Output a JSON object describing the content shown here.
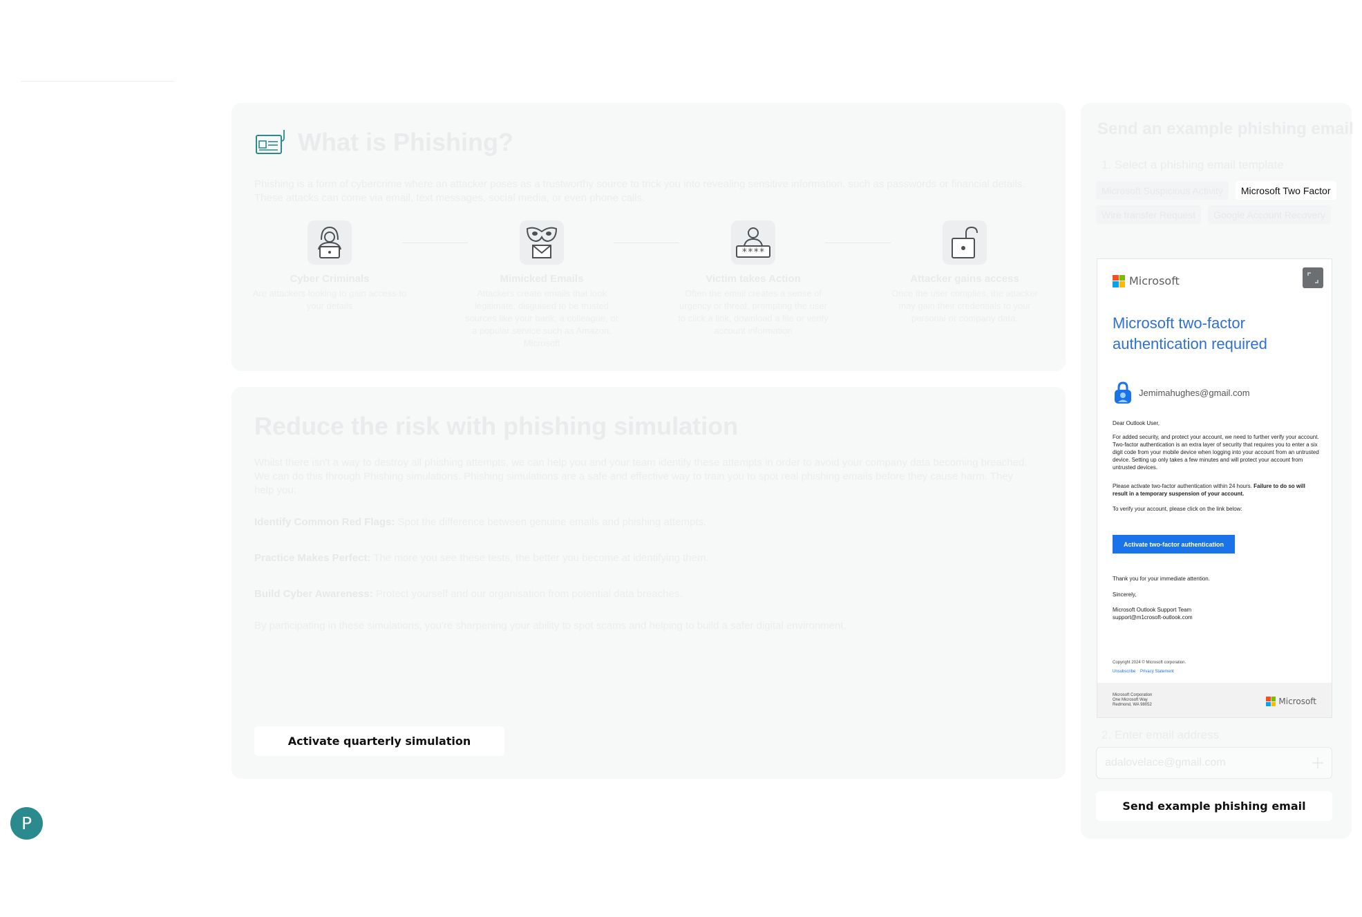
{
  "sidebar": {
    "avatar_initial": "P"
  },
  "what_is": {
    "title": "What is Phishing?",
    "intro": "Phishing is a form of cybercrime where an attacker poses as a trustworthy source to trick you into revealing sensitive information, such as passwords or financial details. These attacks can come via email, text messages, social media, or even phone calls.",
    "steps": [
      {
        "title": "Cyber Criminals",
        "desc": "Are attackers looking to gain access to your details",
        "icon": "hacker-icon"
      },
      {
        "title": "Mimicked Emails",
        "desc": "Attackers create emails that look legitimate, disguised to be trusted sources like your bank, a colleague, or a popular service such as Amazon, Microsoft",
        "icon": "mask-email-icon"
      },
      {
        "title": "Victim takes Action",
        "desc": "Often the email creates a sense of urgency or threat, prompting the user to click a link, download a file or verify account information",
        "icon": "password-user-icon"
      },
      {
        "title": "Attacker gains access",
        "desc": "Once the user complies, the attacker may gain their credentials to your personal or company data.",
        "icon": "unlock-icon"
      }
    ]
  },
  "reduce": {
    "title": "Reduce the risk with phishing simulation",
    "intro": "Whilst there isn't a way to destroy all phishing attempts, we can help you and your team identify these attempts in order to avoid your company data becoming breached. We can do this through Phishing simulations. Phishing simulations are a safe and effective way to train you to spot real phishing emails before they cause harm. They help you:",
    "points": [
      {
        "label": "Identify Common Red Flags:",
        "text": "Spot the difference between genuine emails and phishing attempts."
      },
      {
        "label": "Practice Makes Perfect:",
        "text": "The more you see these tests, the better you become at identifying them."
      },
      {
        "label": "Build Cyber Awareness:",
        "text": "Protect yourself and our organisation from potential data breaches."
      }
    ],
    "outro": "By participating in these simulations, you're sharpening your ability to spot scams and helping to build a safer digital environment.",
    "button": "Activate quarterly simulation"
  },
  "send_panel": {
    "title": "Send an example phishing email",
    "step1": "1.  Select a phishing email template",
    "templates": [
      {
        "label": "Microsoft Suspicious Activity",
        "selected": false
      },
      {
        "label": "Microsoft Two Factor",
        "selected": true
      },
      {
        "label": "Wire transfer Request",
        "selected": false
      },
      {
        "label": "Google Account Recovery",
        "selected": false
      }
    ],
    "step2": "2.  Enter email address",
    "email_placeholder": "adalovelace@gmail.com",
    "send_button": "Send example phishing email"
  },
  "email_preview": {
    "brand": "Microsoft",
    "title": "Microsoft two-factor authentication required",
    "recipient": "Jemimahughes@gmail.com",
    "greeting": "Dear Outlook User,",
    "para1": "For added security, and protect your account, we need to further verify your account. Two-factor authentication is an extra layer of security that requires you to enter a six digit code from your mobile device when logging into your account from an untrusted device. Setting up only takes a few minutes and will protect your account from untrusted devices.",
    "para2_plain": "Please activate two-factor authentication within 24 hours.",
    "para2_bold": "Failure to do so will result in a temporary suspension of your account.",
    "para3": "To verify your account, please click on the link below:",
    "cta": "Activate two-factor authentication",
    "thanks": "Thank you for your immediate attention.",
    "sincerely": "Sincerely,",
    "team": "Microsoft Outlook Support Team",
    "support_email": "support@m1crosoft-outlook.com",
    "copyright": "Copyright 2024 © Microsoft corporation.",
    "link_unsubscribe": "Unsubscribe",
    "link_privacy": "Privacy Statement",
    "footer_line1": "Microsoft Corporation",
    "footer_line2": "One Microsoft Way",
    "footer_line3": "Redmond, WA 98052",
    "logo_colors": [
      "#f25022",
      "#7fba00",
      "#00a4ef",
      "#ffb900"
    ]
  }
}
